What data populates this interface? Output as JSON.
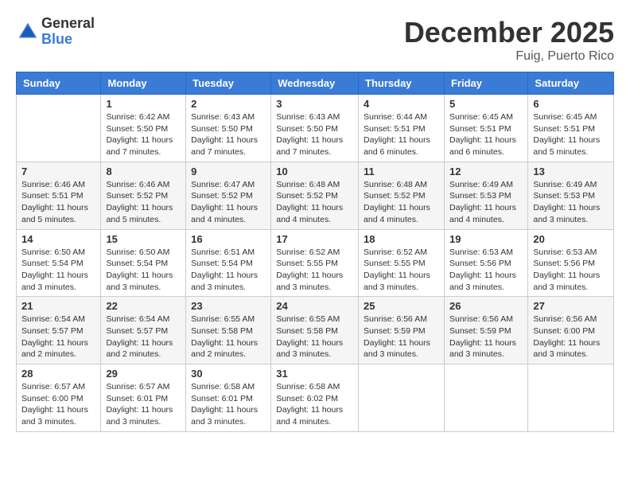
{
  "logo": {
    "general": "General",
    "blue": "Blue"
  },
  "title": {
    "month_year": "December 2025",
    "location": "Fuig, Puerto Rico"
  },
  "header_days": [
    "Sunday",
    "Monday",
    "Tuesday",
    "Wednesday",
    "Thursday",
    "Friday",
    "Saturday"
  ],
  "weeks": [
    [
      {
        "day": "",
        "sunrise": "",
        "sunset": "",
        "daylight": ""
      },
      {
        "day": "1",
        "sunrise": "Sunrise: 6:42 AM",
        "sunset": "Sunset: 5:50 PM",
        "daylight": "Daylight: 11 hours and 7 minutes."
      },
      {
        "day": "2",
        "sunrise": "Sunrise: 6:43 AM",
        "sunset": "Sunset: 5:50 PM",
        "daylight": "Daylight: 11 hours and 7 minutes."
      },
      {
        "day": "3",
        "sunrise": "Sunrise: 6:43 AM",
        "sunset": "Sunset: 5:50 PM",
        "daylight": "Daylight: 11 hours and 7 minutes."
      },
      {
        "day": "4",
        "sunrise": "Sunrise: 6:44 AM",
        "sunset": "Sunset: 5:51 PM",
        "daylight": "Daylight: 11 hours and 6 minutes."
      },
      {
        "day": "5",
        "sunrise": "Sunrise: 6:45 AM",
        "sunset": "Sunset: 5:51 PM",
        "daylight": "Daylight: 11 hours and 6 minutes."
      },
      {
        "day": "6",
        "sunrise": "Sunrise: 6:45 AM",
        "sunset": "Sunset: 5:51 PM",
        "daylight": "Daylight: 11 hours and 5 minutes."
      }
    ],
    [
      {
        "day": "7",
        "sunrise": "Sunrise: 6:46 AM",
        "sunset": "Sunset: 5:51 PM",
        "daylight": "Daylight: 11 hours and 5 minutes."
      },
      {
        "day": "8",
        "sunrise": "Sunrise: 6:46 AM",
        "sunset": "Sunset: 5:52 PM",
        "daylight": "Daylight: 11 hours and 5 minutes."
      },
      {
        "day": "9",
        "sunrise": "Sunrise: 6:47 AM",
        "sunset": "Sunset: 5:52 PM",
        "daylight": "Daylight: 11 hours and 4 minutes."
      },
      {
        "day": "10",
        "sunrise": "Sunrise: 6:48 AM",
        "sunset": "Sunset: 5:52 PM",
        "daylight": "Daylight: 11 hours and 4 minutes."
      },
      {
        "day": "11",
        "sunrise": "Sunrise: 6:48 AM",
        "sunset": "Sunset: 5:52 PM",
        "daylight": "Daylight: 11 hours and 4 minutes."
      },
      {
        "day": "12",
        "sunrise": "Sunrise: 6:49 AM",
        "sunset": "Sunset: 5:53 PM",
        "daylight": "Daylight: 11 hours and 4 minutes."
      },
      {
        "day": "13",
        "sunrise": "Sunrise: 6:49 AM",
        "sunset": "Sunset: 5:53 PM",
        "daylight": "Daylight: 11 hours and 3 minutes."
      }
    ],
    [
      {
        "day": "14",
        "sunrise": "Sunrise: 6:50 AM",
        "sunset": "Sunset: 5:54 PM",
        "daylight": "Daylight: 11 hours and 3 minutes."
      },
      {
        "day": "15",
        "sunrise": "Sunrise: 6:50 AM",
        "sunset": "Sunset: 5:54 PM",
        "daylight": "Daylight: 11 hours and 3 minutes."
      },
      {
        "day": "16",
        "sunrise": "Sunrise: 6:51 AM",
        "sunset": "Sunset: 5:54 PM",
        "daylight": "Daylight: 11 hours and 3 minutes."
      },
      {
        "day": "17",
        "sunrise": "Sunrise: 6:52 AM",
        "sunset": "Sunset: 5:55 PM",
        "daylight": "Daylight: 11 hours and 3 minutes."
      },
      {
        "day": "18",
        "sunrise": "Sunrise: 6:52 AM",
        "sunset": "Sunset: 5:55 PM",
        "daylight": "Daylight: 11 hours and 3 minutes."
      },
      {
        "day": "19",
        "sunrise": "Sunrise: 6:53 AM",
        "sunset": "Sunset: 5:56 PM",
        "daylight": "Daylight: 11 hours and 3 minutes."
      },
      {
        "day": "20",
        "sunrise": "Sunrise: 6:53 AM",
        "sunset": "Sunset: 5:56 PM",
        "daylight": "Daylight: 11 hours and 3 minutes."
      }
    ],
    [
      {
        "day": "21",
        "sunrise": "Sunrise: 6:54 AM",
        "sunset": "Sunset: 5:57 PM",
        "daylight": "Daylight: 11 hours and 2 minutes."
      },
      {
        "day": "22",
        "sunrise": "Sunrise: 6:54 AM",
        "sunset": "Sunset: 5:57 PM",
        "daylight": "Daylight: 11 hours and 2 minutes."
      },
      {
        "day": "23",
        "sunrise": "Sunrise: 6:55 AM",
        "sunset": "Sunset: 5:58 PM",
        "daylight": "Daylight: 11 hours and 2 minutes."
      },
      {
        "day": "24",
        "sunrise": "Sunrise: 6:55 AM",
        "sunset": "Sunset: 5:58 PM",
        "daylight": "Daylight: 11 hours and 3 minutes."
      },
      {
        "day": "25",
        "sunrise": "Sunrise: 6:56 AM",
        "sunset": "Sunset: 5:59 PM",
        "daylight": "Daylight: 11 hours and 3 minutes."
      },
      {
        "day": "26",
        "sunrise": "Sunrise: 6:56 AM",
        "sunset": "Sunset: 5:59 PM",
        "daylight": "Daylight: 11 hours and 3 minutes."
      },
      {
        "day": "27",
        "sunrise": "Sunrise: 6:56 AM",
        "sunset": "Sunset: 6:00 PM",
        "daylight": "Daylight: 11 hours and 3 minutes."
      }
    ],
    [
      {
        "day": "28",
        "sunrise": "Sunrise: 6:57 AM",
        "sunset": "Sunset: 6:00 PM",
        "daylight": "Daylight: 11 hours and 3 minutes."
      },
      {
        "day": "29",
        "sunrise": "Sunrise: 6:57 AM",
        "sunset": "Sunset: 6:01 PM",
        "daylight": "Daylight: 11 hours and 3 minutes."
      },
      {
        "day": "30",
        "sunrise": "Sunrise: 6:58 AM",
        "sunset": "Sunset: 6:01 PM",
        "daylight": "Daylight: 11 hours and 3 minutes."
      },
      {
        "day": "31",
        "sunrise": "Sunrise: 6:58 AM",
        "sunset": "Sunset: 6:02 PM",
        "daylight": "Daylight: 11 hours and 4 minutes."
      },
      {
        "day": "",
        "sunrise": "",
        "sunset": "",
        "daylight": ""
      },
      {
        "day": "",
        "sunrise": "",
        "sunset": "",
        "daylight": ""
      },
      {
        "day": "",
        "sunrise": "",
        "sunset": "",
        "daylight": ""
      }
    ]
  ]
}
